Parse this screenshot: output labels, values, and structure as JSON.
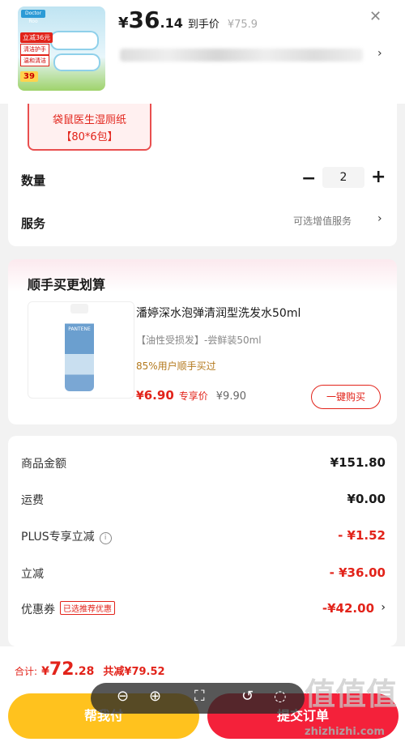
{
  "header": {
    "product_thumb_texts": [
      "Doctor Roo",
      "立减36元",
      "清洁护手",
      "温和清洁",
      "39"
    ],
    "price_yen": "¥",
    "price_int": "36",
    "price_dec": ".14",
    "price_label": "到手价",
    "orig_price": "¥75.9"
  },
  "spec": {
    "chip_line1": "袋鼠医生湿厕纸",
    "chip_line2": "【80*6包】",
    "qty_label": "数量",
    "qty_value": "2",
    "service_label": "服务",
    "service_value": "可选增值服务"
  },
  "upsell": {
    "title": "顺手买更划算",
    "brand_on_bottle": "PANTENE",
    "product_title": "潘婷深水泡弹清润型洗发水50ml",
    "variant": "【油性受损发】-尝鲜装50ml",
    "social_proof": "85%用户顺手买过",
    "price_yen": "¥",
    "price": "6.90",
    "price_label": "专享价",
    "orig_price": "¥9.90",
    "buy_button": "一键购买"
  },
  "totals": {
    "rows": [
      {
        "label": "商品金额",
        "value": "¥151.80"
      },
      {
        "label": "运费",
        "value": "¥0.00"
      },
      {
        "label": "PLUS专享立减",
        "value": "- ¥1.52"
      },
      {
        "label": "立减",
        "value": "- ¥36.00"
      },
      {
        "label": "优惠券",
        "tag": "已选推荐优惠",
        "value": "-¥42.00"
      }
    ]
  },
  "bottom": {
    "total_label": "合计:",
    "total_yen": "¥",
    "total_int": "72",
    "total_dec": ".28",
    "saved": "共减¥79.52",
    "left_button": "帮我付",
    "right_button": "提交订单"
  },
  "watermark": {
    "main": "值值值",
    "url": "zhizhizhi.com"
  },
  "colors": {
    "accent_red": "#e2231a",
    "yellow_button": "#ffc21e",
    "red_button": "#f4213a"
  }
}
